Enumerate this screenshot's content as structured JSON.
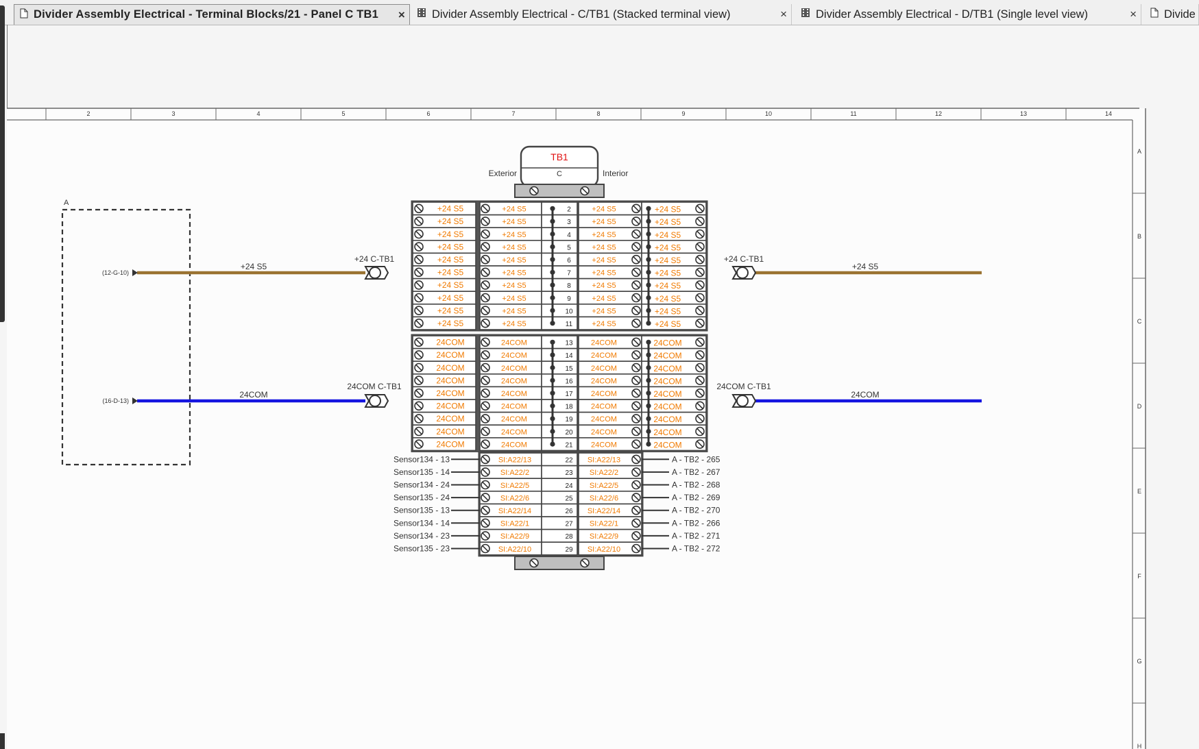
{
  "tabs": [
    {
      "label": "Divider Assembly Electrical - Terminal Blocks/21 - Panel C TB1",
      "icon": "page-icon",
      "active": true
    },
    {
      "label": "Divider Assembly Electrical - C/TB1 (Stacked terminal view)",
      "icon": "film-icon",
      "active": false
    },
    {
      "label": "Divider Assembly Electrical - D/TB1 (Single level view)",
      "icon": "film-icon",
      "active": false
    },
    {
      "label": "Divide",
      "icon": "page-icon",
      "active": false
    }
  ],
  "close_glyph": "×",
  "ruler": {
    "columns": [
      "2",
      "3",
      "4",
      "5",
      "6",
      "7",
      "8",
      "9",
      "10",
      "11",
      "12",
      "13",
      "14"
    ],
    "rows": [
      "A",
      "B",
      "C",
      "D",
      "E",
      "F",
      "G",
      "H"
    ]
  },
  "tb": {
    "name": "TB1",
    "level": "C",
    "left_label": "Exterior",
    "right_label": "Interior"
  },
  "box_label": "A",
  "wires": {
    "s5": {
      "ref": "(12-G-10)",
      "label": "+24 S5",
      "conn_left": "+24 C-TB1",
      "conn_right": "+24 C-TB1",
      "right_label": "+24 S5",
      "color": "#9a7331"
    },
    "com": {
      "ref": "(16-D-13)",
      "label": "24COM",
      "conn_left": "24COM C-TB1",
      "conn_right": "24COM C-TB1",
      "right_label": "24COM",
      "color": "#1515e0"
    }
  },
  "groupA": {
    "numbers": [
      "2",
      "3",
      "4",
      "5",
      "6",
      "7",
      "8",
      "9",
      "10",
      "11"
    ],
    "text": "+24 S5"
  },
  "groupB": {
    "numbers": [
      "13",
      "14",
      "15",
      "16",
      "17",
      "18",
      "19",
      "20",
      "21"
    ],
    "text": "24COM"
  },
  "groupC": [
    {
      "num": "22",
      "left": "SI:A22/13",
      "right": "SI:A22/13",
      "src": "Sensor134 - 13",
      "dst": "A - TB2 - 265"
    },
    {
      "num": "23",
      "left": "SI:A22/2",
      "right": "SI:A22/2",
      "src": "Sensor135 - 14",
      "dst": "A - TB2 - 267"
    },
    {
      "num": "24",
      "left": "SI:A22/5",
      "right": "SI:A22/5",
      "src": "Sensor134 - 24",
      "dst": "A - TB2 - 268"
    },
    {
      "num": "25",
      "left": "SI:A22/6",
      "right": "SI:A22/6",
      "src": "Sensor135 - 24",
      "dst": "A - TB2 - 269"
    },
    {
      "num": "26",
      "left": "SI:A22/14",
      "right": "SI:A22/14",
      "src": "Sensor135 - 13",
      "dst": "A - TB2 - 270"
    },
    {
      "num": "27",
      "left": "SI:A22/1",
      "right": "SI:A22/1",
      "src": "Sensor134 - 14",
      "dst": "A - TB2 - 266"
    },
    {
      "num": "28",
      "left": "SI:A22/9",
      "right": "SI:A22/9",
      "src": "Sensor134 - 23",
      "dst": "A - TB2 - 271"
    },
    {
      "num": "29",
      "left": "SI:A22/10",
      "right": "SI:A22/10",
      "src": "Sensor135 - 23",
      "dst": "A - TB2 - 272"
    }
  ],
  "colors": {
    "title_red": "#e01010",
    "terminal_orange": "#f07a00",
    "frame": "#444444"
  }
}
